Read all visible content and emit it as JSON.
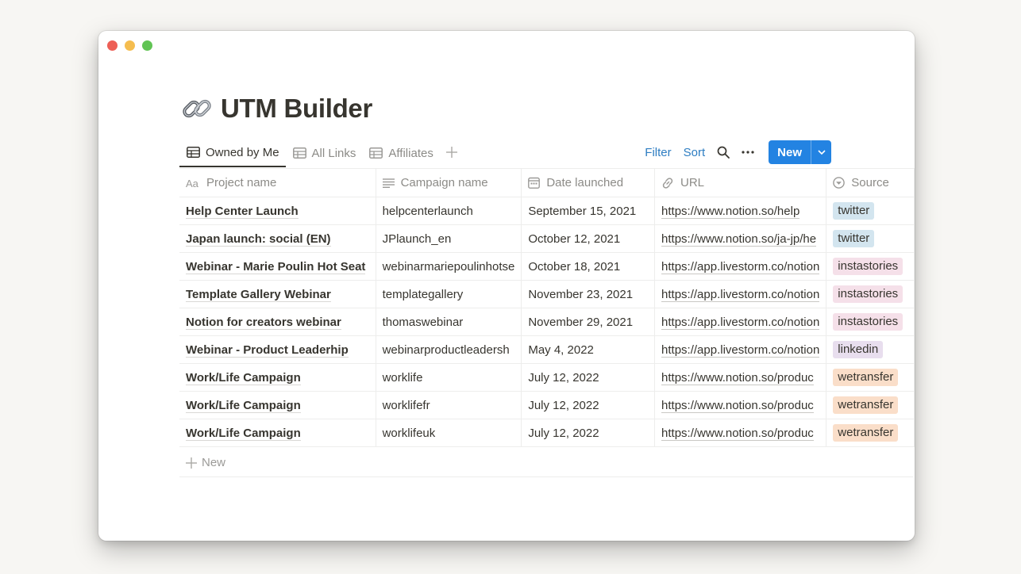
{
  "page": {
    "title": "UTM Builder",
    "icon": "link-icon"
  },
  "views": {
    "tabs": [
      {
        "label": "Owned by Me",
        "icon": "table-icon",
        "active": true
      },
      {
        "label": "All Links",
        "icon": "table-icon",
        "active": false
      },
      {
        "label": "Affiliates",
        "icon": "table-icon",
        "active": false
      }
    ],
    "add_icon": "plus-icon"
  },
  "toolbar": {
    "filter_label": "Filter",
    "sort_label": "Sort",
    "search_icon": "search-icon",
    "more_icon": "more-icon",
    "new_label": "New",
    "new_caret_icon": "chevron-down-icon"
  },
  "table": {
    "columns": [
      {
        "label": "Project name",
        "icon": "title-icon"
      },
      {
        "label": "Campaign name",
        "icon": "text-icon"
      },
      {
        "label": "Date launched",
        "icon": "calendar-icon"
      },
      {
        "label": "URL",
        "icon": "link-icon"
      },
      {
        "label": "Source",
        "icon": "select-icon"
      }
    ],
    "rows": [
      {
        "project": "Help Center Launch",
        "campaign": "helpcenterlaunch",
        "date": "September 15, 2021",
        "url": "https://www.notion.so/help",
        "source": "twitter"
      },
      {
        "project": "Japan launch: social (EN)",
        "campaign": "JPlaunch_en",
        "date": "October 12, 2021",
        "url": "https://www.notion.so/ja-jp/he",
        "source": "twitter"
      },
      {
        "project": "Webinar - Marie Poulin Hot Seat",
        "campaign": "webinarmariepoulinhotse",
        "date": "October 18, 2021",
        "url": "https://app.livestorm.co/notion",
        "source": "instastories"
      },
      {
        "project": "Template Gallery Webinar",
        "campaign": "templategallery",
        "date": "November 23, 2021",
        "url": "https://app.livestorm.co/notion",
        "source": "instastories"
      },
      {
        "project": "Notion for creators webinar",
        "campaign": "thomaswebinar",
        "date": "November 29, 2021",
        "url": "https://app.livestorm.co/notion",
        "source": "instastories"
      },
      {
        "project": "Webinar - Product Leaderhip",
        "campaign": "webinarproductleadersh",
        "date": "May 4, 2022",
        "url": "https://app.livestorm.co/notion",
        "source": "linkedin"
      },
      {
        "project": "Work/Life Campaign",
        "campaign": "worklife",
        "date": "July 12, 2022",
        "url": "https://www.notion.so/produc",
        "source": "wetransfer"
      },
      {
        "project": "Work/Life Campaign",
        "campaign": "worklifefr",
        "date": "July 12, 2022",
        "url": "https://www.notion.so/produc",
        "source": "wetransfer"
      },
      {
        "project": "Work/Life Campaign",
        "campaign": "worklifeuk",
        "date": "July 12, 2022",
        "url": "https://www.notion.so/produc",
        "source": "wetransfer"
      }
    ],
    "new_row_label": "New"
  },
  "colors": {
    "accent": "#2383e2",
    "link": "#2d7dc2",
    "twitter": "#d3e5ef",
    "instastories": "#f5e0e9",
    "linkedin": "#e8deee",
    "wetransfer": "#fadec9"
  }
}
